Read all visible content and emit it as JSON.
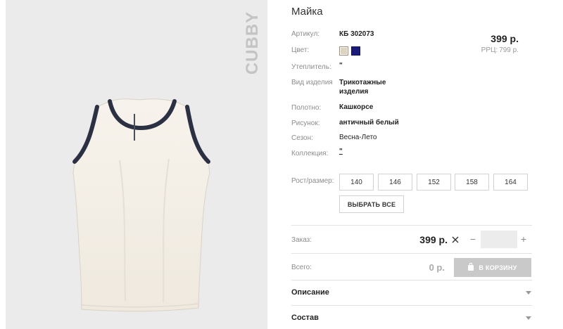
{
  "product": {
    "title": "Майка",
    "brand": "CUBBY",
    "price": "399 р.",
    "rrp_label": "РРЦ:",
    "rrp_value": "799 р."
  },
  "attributes": {
    "article": {
      "label": "Артикул:",
      "value": "КБ 302073"
    },
    "color": {
      "label": "Цвет:",
      "swatches": [
        "#ddd3c0",
        "#1b1b7a"
      ]
    },
    "insulation": {
      "label": "Утеплитель:",
      "value": "\""
    },
    "item_type": {
      "label": "Вид изделия",
      "value": "Трикотажные изделия"
    },
    "fabric": {
      "label": "Полотно:",
      "value": "Кашкорсе"
    },
    "pattern": {
      "label": "Рисунок:",
      "value": "античный белый"
    },
    "season": {
      "label": "Сезон:",
      "value": "Весна-Лето"
    },
    "collection": {
      "label": "Коллекция:",
      "value": "\""
    }
  },
  "sizes": {
    "label": "Рост/размер:",
    "options": [
      "140",
      "146",
      "152",
      "158",
      "164"
    ],
    "select_all": "ВЫБРАТЬ ВСЕ"
  },
  "order": {
    "label": "Заказ:",
    "price": "399 р.",
    "minus": "−",
    "plus": "+",
    "quantity": ""
  },
  "total": {
    "label": "Всего:",
    "value": "0 р.",
    "cart_button": "В КОРЗИНУ"
  },
  "accordion": {
    "description": "Описание",
    "composition": "Состав"
  }
}
